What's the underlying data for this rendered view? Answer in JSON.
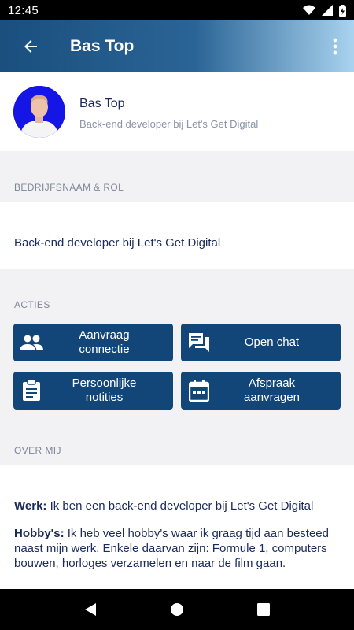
{
  "status_bar": {
    "time": "12:45"
  },
  "app_bar": {
    "title": "Bas Top"
  },
  "profile": {
    "name": "Bas Top",
    "subtitle": "Back-end developer bij Let's Get Digital"
  },
  "sections": {
    "company_header": "BEDRIJFSNAAM & ROL",
    "actions_header": "ACTIES",
    "about_header": "OVER MIJ"
  },
  "company": {
    "text": "Back-end developer bij Let's Get Digital"
  },
  "actions": [
    {
      "line1": "Aanvraag",
      "line2": "connectie",
      "icon": "people-icon"
    },
    {
      "line1": "Open chat",
      "line2": "",
      "icon": "chat-icon"
    },
    {
      "line1": "Persoonlijke",
      "line2": "notities",
      "icon": "clipboard-icon"
    },
    {
      "line1": "Afspraak",
      "line2": "aanvragen",
      "icon": "calendar-icon"
    }
  ],
  "about": {
    "work_label": "Werk:",
    "work_text": " Ik ben een back-end developer bij Let's Get Digital",
    "hobby_label": "Hobby's:",
    "hobby_text": " Ik heb veel hobby's waar ik graag tijd aan besteed naast mijn werk. Enkele daarvan zijn: Formule 1, computers bouwen, horloges verzamelen en naar de film gaan."
  },
  "colors": {
    "primary": "#134678",
    "gradient_start": "#1a4f7e",
    "gradient_end": "#a9d3ef",
    "avatar_bg": "#1515e6"
  }
}
